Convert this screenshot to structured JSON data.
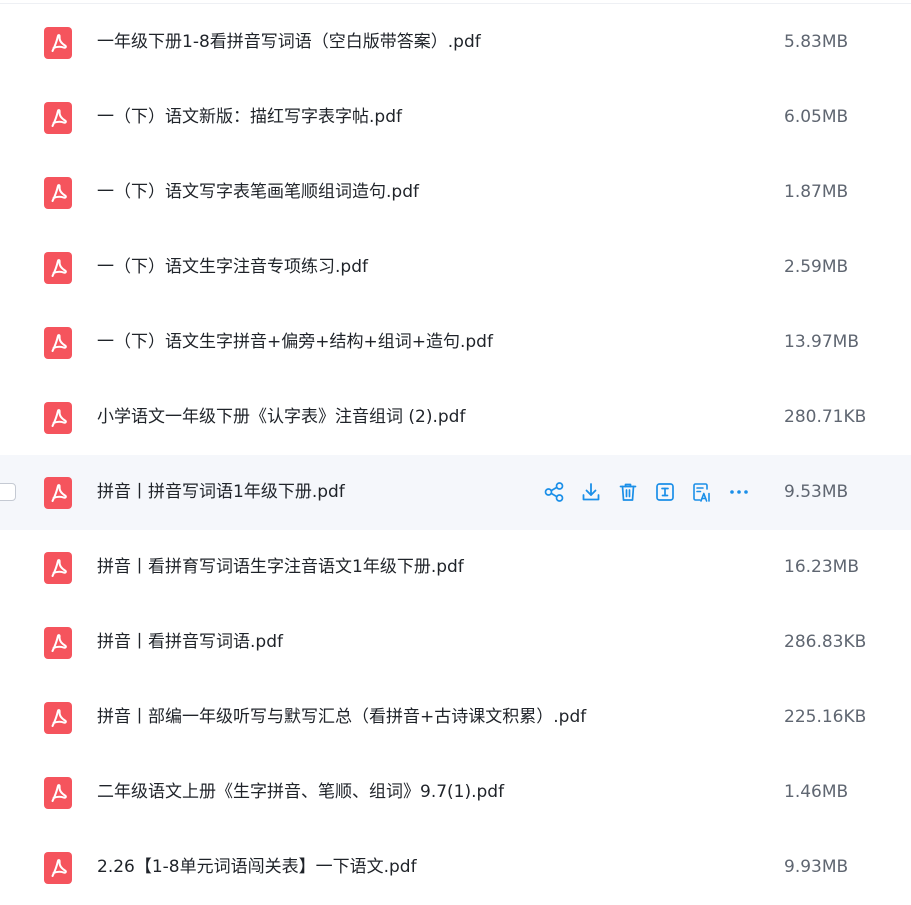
{
  "colors": {
    "pdf_icon": "#f5545d",
    "action_icon": "#1b8fe8",
    "hover_row": "#f5f7fb",
    "text_primary": "#1f2329",
    "text_secondary": "#5f6671"
  },
  "row_actions": {
    "share": "share-icon",
    "download": "download-icon",
    "delete": "trash-icon",
    "text_extract": "text-extract-icon",
    "ai_translate": "ai-translate-icon",
    "more": "more-icon"
  },
  "files": [
    {
      "name": "一年级下册1-8看拼音写词语（空白版带答案）.pdf",
      "size": "5.83MB"
    },
    {
      "name": "一（下）语文新版：描红写字表字帖.pdf",
      "size": "6.05MB"
    },
    {
      "name": "一（下）语文写字表笔画笔顺组词造句.pdf",
      "size": "1.87MB"
    },
    {
      "name": "一（下）语文生字注音专项练习.pdf",
      "size": "2.59MB"
    },
    {
      "name": "一（下）语文生字拼音+偏旁+结构+组词+造句.pdf",
      "size": "13.97MB"
    },
    {
      "name": "小学语文一年级下册《认字表》注音组词 (2).pdf",
      "size": "280.71KB"
    },
    {
      "name": "拼音丨拼音写词语1年级下册.pdf",
      "size": "9.53MB"
    },
    {
      "name": "拼音丨看拼育写词语生字注音语文1年级下册.pdf",
      "size": "16.23MB"
    },
    {
      "name": "拼音丨看拼音写词语.pdf",
      "size": "286.83KB"
    },
    {
      "name": "拼音丨部编一年级听写与默写汇总（看拼音+古诗课文积累）.pdf",
      "size": "225.16KB"
    },
    {
      "name": "二年级语文上册《生字拼音、笔顺、组词》9.7(1).pdf",
      "size": "1.46MB"
    },
    {
      "name": "2.26【1-8单元词语闯关表】一下语文.pdf",
      "size": "9.93MB"
    }
  ]
}
